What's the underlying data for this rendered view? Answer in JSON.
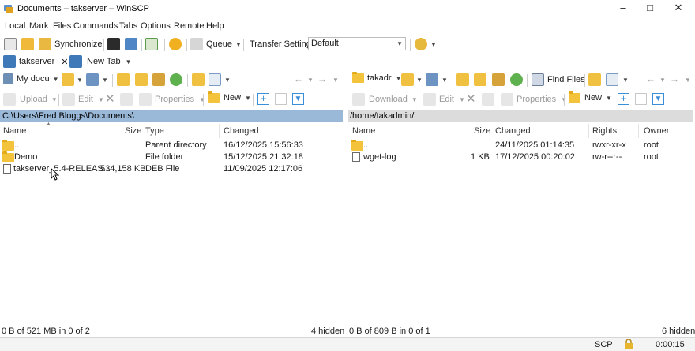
{
  "window": {
    "title": "Documents – takserver – WinSCP"
  },
  "menu": [
    "Local",
    "Mark",
    "Files",
    "Commands",
    "Tabs",
    "Options",
    "Remote",
    "Help"
  ],
  "toolbar": {
    "synchronize": "Synchronize",
    "queue": "Queue",
    "transfer_settings_label": "Transfer Settings",
    "transfer_settings_value": "Default"
  },
  "tabs": {
    "session": "takserver",
    "new_tab": "New Tab"
  },
  "left": {
    "location": "My docu",
    "toolbar": {
      "upload": "Upload",
      "edit": "Edit",
      "properties": "Properties",
      "new": "New"
    },
    "path": "C:\\Users\\Fred Bloggs\\Documents\\",
    "headers": {
      "name": "Name",
      "size": "Size",
      "type": "Type",
      "changed": "Changed"
    },
    "rows": [
      {
        "name": "..",
        "size": "",
        "type": "Parent directory",
        "changed": "16/12/2025 15:56:33",
        "icon": "parent-folder-icon"
      },
      {
        "name": "Demo",
        "size": "",
        "type": "File folder",
        "changed": "15/12/2025 21:32:18",
        "icon": "folder-icon"
      },
      {
        "name": "takserver_5.4-RELEAS...",
        "size": "534,158 KB",
        "type": "DEB File",
        "changed": "11/09/2025 12:17:06",
        "icon": "file-icon"
      }
    ],
    "status_left": "0 B of 521 MB in 0 of 2",
    "status_right": "4 hidden"
  },
  "right": {
    "location": "takadr",
    "find_files": "Find Files",
    "toolbar": {
      "download": "Download",
      "edit": "Edit",
      "properties": "Properties",
      "new": "New"
    },
    "path": "/home/takadmin/",
    "headers": {
      "name": "Name",
      "size": "Size",
      "changed": "Changed",
      "rights": "Rights",
      "owner": "Owner"
    },
    "rows": [
      {
        "name": "..",
        "size": "",
        "changed": "24/11/2025 01:14:35",
        "rights": "rwxr-xr-x",
        "owner": "root",
        "icon": "parent-folder-icon"
      },
      {
        "name": "wget-log",
        "size": "1 KB",
        "changed": "17/12/2025 00:20:02",
        "rights": "rw-r--r--",
        "owner": "root",
        "icon": "file-icon"
      }
    ],
    "status_left": "0 B of 809 B in 0 of 1",
    "status_right": "6 hidden"
  },
  "statusbar": {
    "protocol": "SCP",
    "elapsed": "0:00:15"
  },
  "colors": {
    "active_path": "#9ab8d8",
    "inactive_path": "#dcdcdc",
    "folder": "#f2c33b",
    "accent": "#2f7fd1"
  }
}
